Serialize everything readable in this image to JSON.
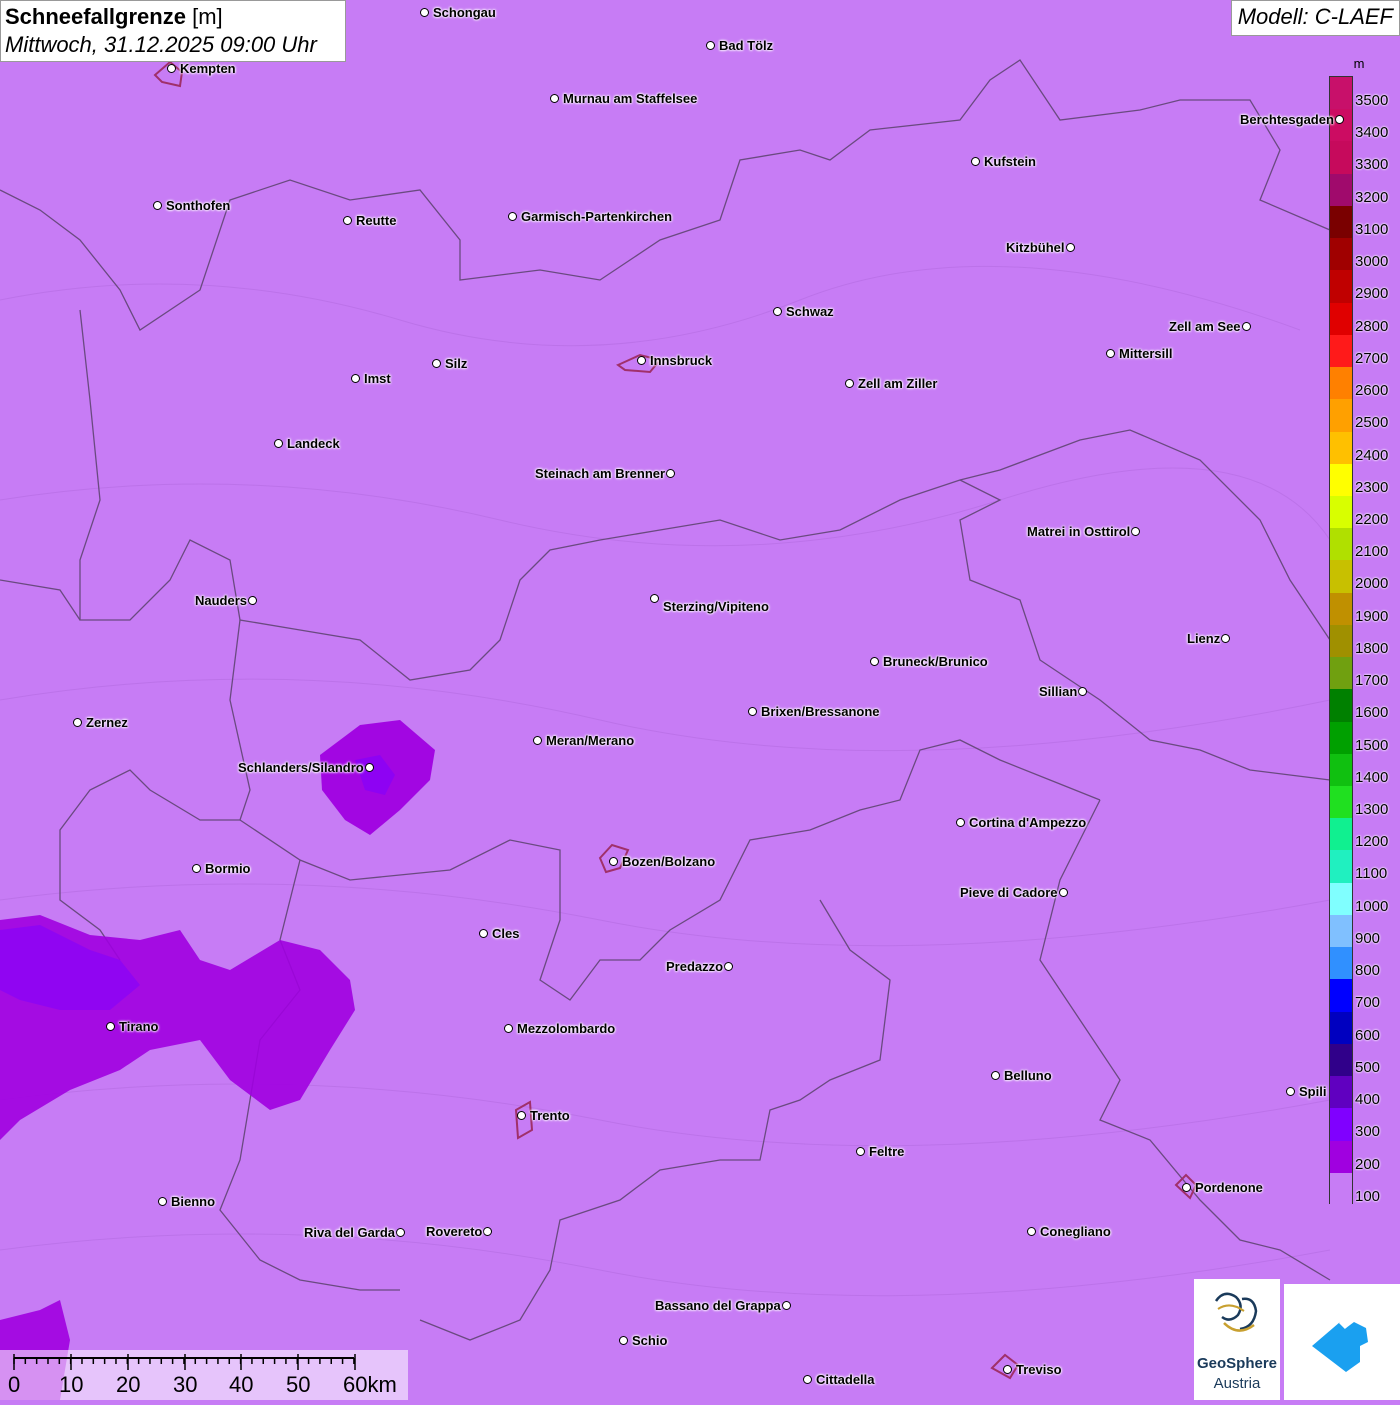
{
  "title": {
    "main": "Schneefallgrenze",
    "unit": "[m]",
    "datetime": "Mittwoch, 31.12.2025 09:00 Uhr"
  },
  "model": "Modell: C-LAEF",
  "legend": {
    "unit": "m",
    "labels": [
      "3500",
      "3400",
      "3300",
      "3200",
      "3100",
      "3000",
      "2900",
      "2800",
      "2700",
      "2600",
      "2500",
      "2400",
      "2300",
      "2200",
      "2100",
      "2000",
      "1900",
      "1800",
      "1700",
      "1600",
      "1500",
      "1400",
      "1300",
      "1200",
      "1100",
      "1000",
      "900",
      "800",
      "700",
      "600",
      "500",
      "400",
      "300",
      "200",
      "100"
    ],
    "colors": [
      "#c8106a",
      "#cc0c62",
      "#c60a5c",
      "#a00a6c",
      "#7a0000",
      "#a00000",
      "#c00000",
      "#e00000",
      "#ff1a1a",
      "#ff8000",
      "#ffa000",
      "#ffc000",
      "#ffff00",
      "#d8ff00",
      "#b0e000",
      "#c8c000",
      "#c09000",
      "#a09000",
      "#70a010",
      "#008000",
      "#00a000",
      "#10c010",
      "#20e020",
      "#10f090",
      "#20f0c0",
      "#80ffff",
      "#80c0ff",
      "#3090ff",
      "#0000ff",
      "#0000c0",
      "#30008a",
      "#6000c0",
      "#8000ff",
      "#a000e0",
      "#c77cf5"
    ]
  },
  "cities": [
    {
      "name": "Schongau"
    },
    {
      "name": "Bad Tölz"
    },
    {
      "name": "Kempten"
    },
    {
      "name": "Murnau am Staffelsee"
    },
    {
      "name": "Berchtesgaden"
    },
    {
      "name": "Kufstein"
    },
    {
      "name": "Sonthofen"
    },
    {
      "name": "Reutte"
    },
    {
      "name": "Garmisch-Partenkirchen"
    },
    {
      "name": "Kitzbühel"
    },
    {
      "name": "Schwaz"
    },
    {
      "name": "Zell am See"
    },
    {
      "name": "Innsbruck"
    },
    {
      "name": "Mittersill"
    },
    {
      "name": "Imst"
    },
    {
      "name": "Silz"
    },
    {
      "name": "Zell am Ziller"
    },
    {
      "name": "Landeck"
    },
    {
      "name": "Steinach am Brenner"
    },
    {
      "name": "Matrei in Osttirol"
    },
    {
      "name": "Nauders"
    },
    {
      "name": "Sterzing/Vipiteno"
    },
    {
      "name": "Lienz"
    },
    {
      "name": "Bruneck/Brunico"
    },
    {
      "name": "Sillian"
    },
    {
      "name": "Zernez"
    },
    {
      "name": "Brixen/Bressanone"
    },
    {
      "name": "Meran/Merano"
    },
    {
      "name": "Schlanders/Silandro"
    },
    {
      "name": "Cortina d'Ampezzo"
    },
    {
      "name": "Bormio"
    },
    {
      "name": "Bozen/Bolzano"
    },
    {
      "name": "Pieve di Cadore"
    },
    {
      "name": "Cles"
    },
    {
      "name": "Predazzo"
    },
    {
      "name": "Tirano"
    },
    {
      "name": "Mezzolombardo"
    },
    {
      "name": "Belluno"
    },
    {
      "name": "Spili"
    },
    {
      "name": "Trento"
    },
    {
      "name": "Feltre"
    },
    {
      "name": "Bienno"
    },
    {
      "name": "Pordenone"
    },
    {
      "name": "Riva del Garda"
    },
    {
      "name": "Rovereto"
    },
    {
      "name": "Conegliano"
    },
    {
      "name": "Bassano del Grappa"
    },
    {
      "name": "Schio"
    },
    {
      "name": "Treviso"
    },
    {
      "name": "Cittadella"
    }
  ],
  "scale": {
    "labels": [
      "0",
      "10",
      "20",
      "30",
      "40",
      "50",
      "60km"
    ]
  },
  "logos": {
    "geosphere_line1": "GeoSphere",
    "geosphere_line2": "Austria"
  }
}
